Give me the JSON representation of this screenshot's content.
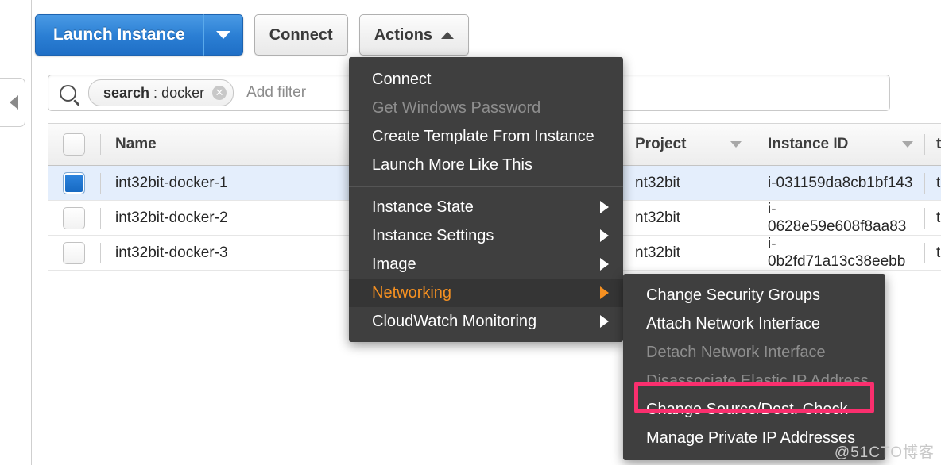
{
  "toolbar": {
    "launch_label": "Launch Instance",
    "launch_caret_icon": "caret-down-icon",
    "connect_label": "Connect",
    "actions_label": "Actions",
    "actions_caret_icon": "caret-up-icon"
  },
  "left_rail": {
    "collapse_icon": "triangle-left-icon"
  },
  "filter": {
    "search_icon": "search-icon",
    "token_key": "search",
    "token_separator": ":",
    "token_value": "docker",
    "token_clear_icon": "close-circle-icon",
    "add_filter_label": "Add filter"
  },
  "table": {
    "columns": [
      {
        "label": "Name",
        "sortable": false
      },
      {
        "label": "",
        "sortable": false
      },
      {
        "label": "Project",
        "sortable": true
      },
      {
        "label": "Instance ID",
        "sortable": true
      },
      {
        "label": "t",
        "sortable": false
      }
    ],
    "rows": [
      {
        "selected": true,
        "name": "int32bit-docker-1",
        "mid": "",
        "project": "nt32bit",
        "instance_id": "i-031159da8cb1bf143",
        "last": "t"
      },
      {
        "selected": false,
        "name": "int32bit-docker-2",
        "mid": "",
        "project": "nt32bit",
        "instance_id": "i-0628e59e608f8aa83",
        "last": "t"
      },
      {
        "selected": false,
        "name": "int32bit-docker-3",
        "mid": "",
        "project": "nt32bit",
        "instance_id": "i-0b2fd71a13c38eebb",
        "last": "t"
      }
    ]
  },
  "actions_menu": {
    "items": [
      {
        "label": "Connect",
        "state": "normal",
        "submenu": false
      },
      {
        "label": "Get Windows Password",
        "state": "disabled",
        "submenu": false
      },
      {
        "label": "Create Template From Instance",
        "state": "normal",
        "submenu": false
      },
      {
        "label": "Launch More Like This",
        "state": "normal",
        "submenu": false
      },
      {
        "label": "Instance State",
        "state": "normal",
        "submenu": true
      },
      {
        "label": "Instance Settings",
        "state": "normal",
        "submenu": true
      },
      {
        "label": "Image",
        "state": "normal",
        "submenu": true
      },
      {
        "label": "Networking",
        "state": "highlight",
        "submenu": true
      },
      {
        "label": "CloudWatch Monitoring",
        "state": "normal",
        "submenu": true
      }
    ],
    "divider_after_index": 3
  },
  "networking_submenu": {
    "items": [
      {
        "label": "Change Security Groups",
        "state": "normal",
        "highlighted_box": false
      },
      {
        "label": "Attach Network Interface",
        "state": "normal",
        "highlighted_box": false
      },
      {
        "label": "Detach Network Interface",
        "state": "disabled",
        "highlighted_box": false
      },
      {
        "label": "Disassociate Elastic IP Address",
        "state": "disabled",
        "highlighted_box": false
      },
      {
        "label": "Change Source/Dest. Check",
        "state": "normal",
        "highlighted_box": true
      },
      {
        "label": "Manage Private IP Addresses",
        "state": "normal",
        "highlighted_box": false
      }
    ]
  },
  "watermark": {
    "text": "@51CTO博客"
  },
  "colors": {
    "primary_button": "#2b7fd4",
    "menu_background": "#3f3f3f",
    "menu_highlight_text": "#f59021",
    "menu_highlight_background": "#353535",
    "selected_row": "#e4eefc",
    "annotation_box": "#fa2f6e",
    "checkbox_checked": "#1f6fc6"
  }
}
